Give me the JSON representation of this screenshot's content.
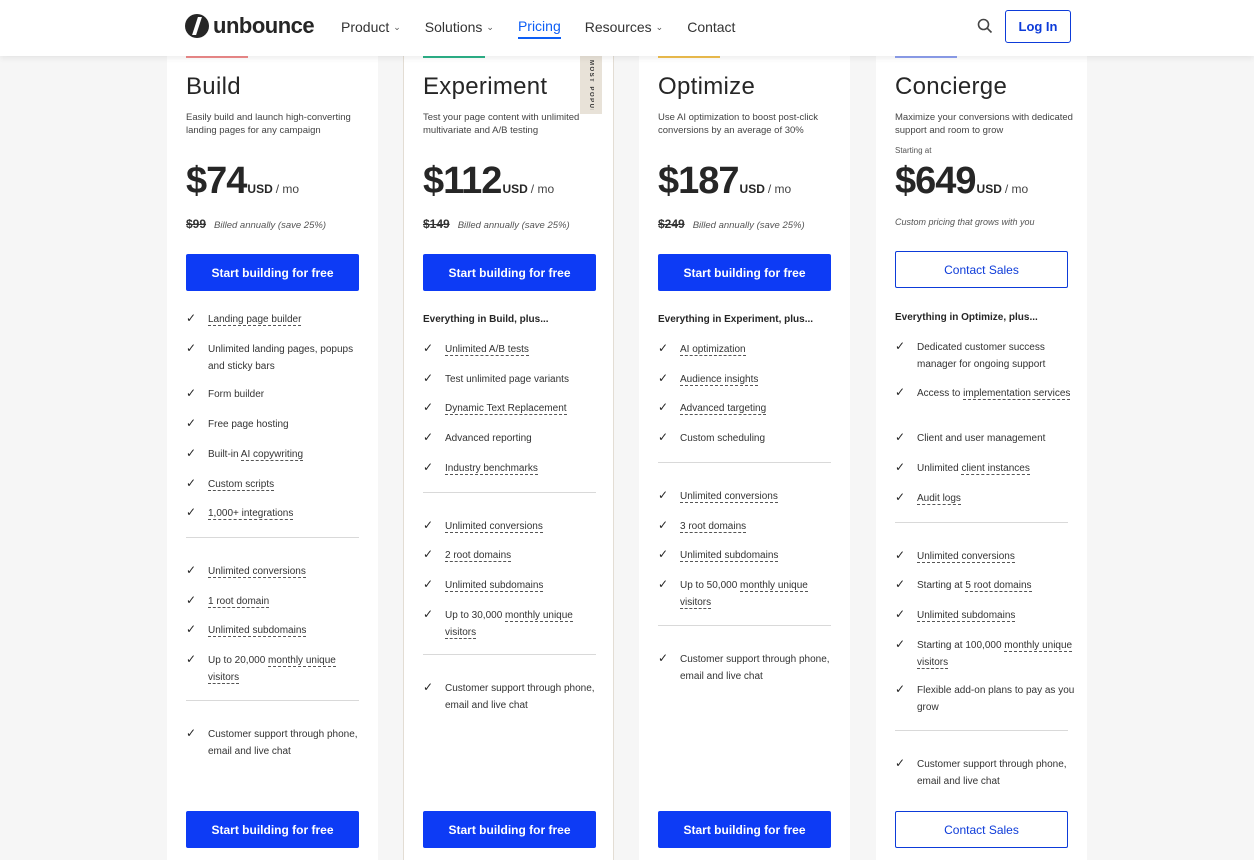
{
  "header": {
    "logo_text": "unbounce",
    "nav": [
      {
        "label": "Product",
        "has_menu": true,
        "active": false
      },
      {
        "label": "Solutions",
        "has_menu": true,
        "active": false
      },
      {
        "label": "Pricing",
        "has_menu": false,
        "active": true
      },
      {
        "label": "Resources",
        "has_menu": true,
        "active": false
      },
      {
        "label": "Contact",
        "has_menu": false,
        "active": false
      }
    ],
    "search_icon": "search-icon",
    "login_label": "Log In"
  },
  "colors": {
    "primary": "#0d3bf5",
    "build_accent": "#f08b8b",
    "experiment_accent": "#2db38a",
    "optimize_accent": "#f2c14e",
    "concierge_accent": "#8ea0f0"
  },
  "plans": [
    {
      "name": "Build",
      "desc": "Easily build and launch high-converting landing pages for any campaign",
      "price": "$74",
      "currency": "USD",
      "period": "/ mo",
      "old_price": "$99",
      "billed": "Billed annually (save 25%)",
      "cta": "Start building for free",
      "lead": "",
      "features": [
        [
          "",
          "Landing page builder",
          ""
        ],
        [
          "Unlimited landing pages, popups and sticky bars",
          "",
          ""
        ],
        [
          "Form builder",
          "",
          ""
        ],
        [
          "Free page hosting",
          "",
          ""
        ],
        [
          "Built-in ",
          "AI copywriting",
          ""
        ],
        [
          "",
          "Custom scripts",
          ""
        ],
        [
          "",
          "1,000+ integrations",
          ""
        ]
      ],
      "limits": [
        [
          "",
          "Unlimited conversions",
          ""
        ],
        [
          "",
          "1 root domain",
          ""
        ],
        [
          "",
          "Unlimited subdomains",
          ""
        ],
        [
          "Up to 20,000 ",
          "monthly unique visitors",
          ""
        ]
      ],
      "support": "Customer support through phone, email and live chat",
      "bottom_cta": "Start building for free"
    },
    {
      "name": "Experiment",
      "ribbon": "MOST POPULAR",
      "desc": "Test your page content with unlimited multivariate and A/B testing",
      "price": "$112",
      "currency": "USD",
      "period": "/ mo",
      "old_price": "$149",
      "billed": "Billed annually (save 25%)",
      "cta": "Start building for free",
      "lead": "Everything in Build, plus...",
      "features": [
        [
          "",
          "Unlimited A/B tests",
          ""
        ],
        [
          "Test unlimited page variants",
          "",
          ""
        ],
        [
          "",
          "Dynamic Text Replacement",
          ""
        ],
        [
          "Advanced reporting",
          "",
          ""
        ],
        [
          "",
          "Industry benchmarks",
          ""
        ]
      ],
      "limits": [
        [
          "",
          "Unlimited conversions",
          ""
        ],
        [
          "",
          "2 root domains",
          ""
        ],
        [
          "",
          "Unlimited subdomains",
          ""
        ],
        [
          "Up to 30,000 ",
          "monthly unique visitors",
          ""
        ]
      ],
      "support": "Customer support through phone, email and live chat",
      "bottom_cta": "Start building for free"
    },
    {
      "name": "Optimize",
      "desc": "Use AI optimization to boost post-click conversions by an average of 30%",
      "price": "$187",
      "currency": "USD",
      "period": "/ mo",
      "old_price": "$249",
      "billed": "Billed annually (save 25%)",
      "cta": "Start building for free",
      "lead": "Everything in Experiment, plus...",
      "features": [
        [
          "",
          "AI optimization",
          ""
        ],
        [
          "",
          "Audience insights",
          ""
        ],
        [
          "",
          "Advanced targeting",
          ""
        ],
        [
          "Custom scheduling",
          "",
          ""
        ]
      ],
      "limits": [
        [
          "",
          "Unlimited conversions",
          ""
        ],
        [
          "",
          "3 root domains",
          ""
        ],
        [
          "",
          "Unlimited subdomains",
          ""
        ],
        [
          "Up to 50,000 ",
          "monthly unique visitors",
          ""
        ]
      ],
      "support": "Customer support through phone, email and live chat",
      "bottom_cta": "Start building for free"
    },
    {
      "name": "Concierge",
      "desc": "Maximize your conversions with dedicated support and room to grow",
      "starting": "Starting at",
      "price": "$649",
      "currency": "USD",
      "period": "/ mo",
      "custom_note": "Custom pricing that grows with you",
      "cta": "Contact Sales",
      "lead": "Everything in Optimize, plus...",
      "features": [
        [
          "Dedicated customer success manager for ongoing support",
          "",
          ""
        ],
        [
          "Access to ",
          "implementation services",
          ""
        ],
        [
          "Client and user management",
          "",
          ""
        ],
        [
          "Unlimited ",
          "client instances",
          ""
        ],
        [
          "",
          "Audit logs",
          ""
        ]
      ],
      "limits": [
        [
          "",
          "Unlimited conversions",
          ""
        ],
        [
          "Starting at ",
          "5 root domains",
          ""
        ],
        [
          "",
          "Unlimited subdomains",
          ""
        ],
        [
          "Starting at 100,000 ",
          "monthly unique visitors",
          ""
        ],
        [
          "Flexible add-on plans to pay as you grow",
          "",
          ""
        ]
      ],
      "support": "Customer support through phone, email and live chat",
      "bottom_cta": "Contact Sales"
    }
  ]
}
